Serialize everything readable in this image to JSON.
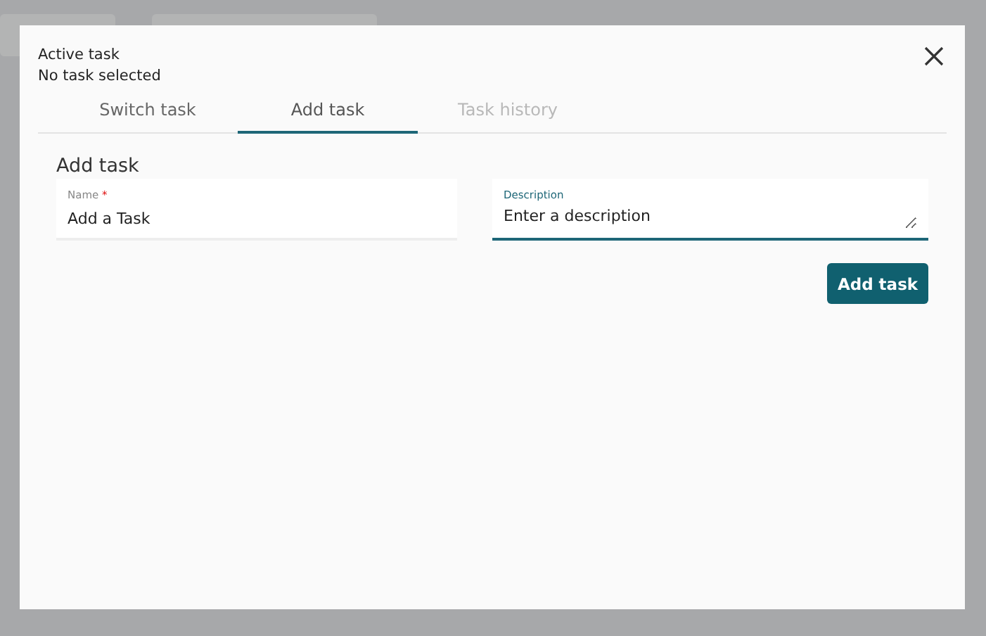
{
  "dialog": {
    "title": "Active task",
    "subtitle": "No task selected"
  },
  "tabs": [
    {
      "label": "Switch task",
      "selected": false,
      "disabled": false
    },
    {
      "label": "Add task",
      "selected": true,
      "disabled": false
    },
    {
      "label": "Task history",
      "selected": false,
      "disabled": true
    }
  ],
  "form": {
    "heading": "Add task",
    "fields": [
      {
        "label": "Name",
        "required_mark": "*",
        "placeholder": "Add a Task",
        "kind": "input",
        "focused": false
      },
      {
        "label": "Description",
        "placeholder": "Enter a description",
        "kind": "textarea",
        "focused": true
      }
    ],
    "submit": "Add task"
  }
}
